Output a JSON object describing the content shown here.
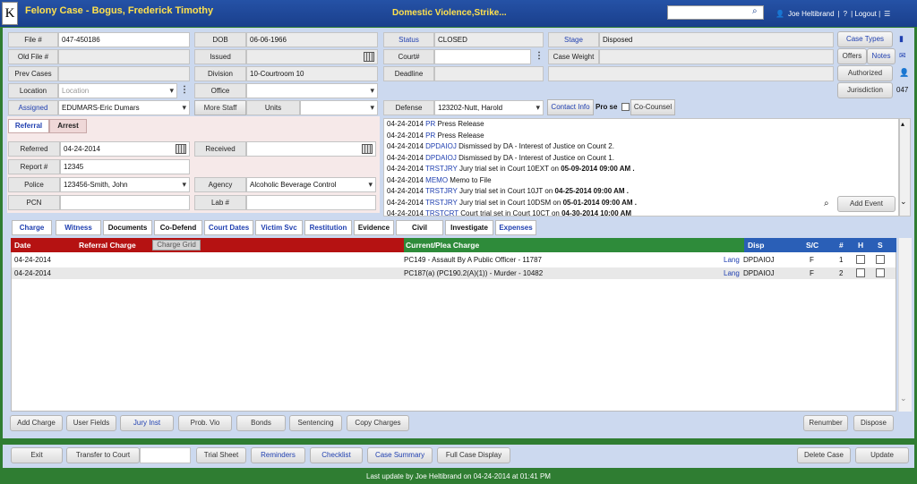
{
  "header": {
    "logo": "K",
    "title": "Felony Case - Bogus, Frederick Timothy",
    "flags": "Domestic Violence,Strike...",
    "search_placeholder": "",
    "user": "Joe Heltibrand",
    "help": "|",
    "logout": "| Logout |",
    "menu": "☰"
  },
  "left": {
    "file_label": "File #",
    "file_value": "047-450186",
    "old_file_label": "Old File #",
    "old_file_value": "",
    "prev_cases_label": "Prev Cases",
    "prev_cases_value": "",
    "location_label": "Location",
    "location_value": "Location",
    "assigned_label": "Assigned",
    "assigned_value": "EDUMARS-Eric Dumars"
  },
  "mid": {
    "dob_label": "DOB",
    "dob_value": "06-06-1966",
    "issued_label": "Issued",
    "issued_value": "",
    "division_label": "Division",
    "division_value": "10-Courtroom 10",
    "office_label": "Office",
    "office_value": "",
    "more_staff_label": "More Staff",
    "units_label": "Units",
    "units_value": ""
  },
  "right": {
    "status_label": "Status",
    "status_value": "CLOSED",
    "court_label": "Court#",
    "court_value": "",
    "deadline_label": "Deadline",
    "deadline_value": "",
    "defense_label": "Defense",
    "defense_value": "123202-Nutt, Harold",
    "contact_info": "Contact Info",
    "pro_se": "Pro se",
    "co_counsel": "Co-Counsel",
    "stage_label": "Stage",
    "stage_value": "Disposed",
    "case_weight_label": "Case Weight",
    "case_weight_value": ""
  },
  "side_buttons": {
    "case_types": "Case Types",
    "offers": "Offers",
    "notes": "Notes",
    "authorized": "Authorized",
    "jurisdiction": "Jurisdiction",
    "jurisdiction_value": "047"
  },
  "referral": {
    "tab_referral": "Referral",
    "tab_arrest": "Arrest",
    "referred_label": "Referred",
    "referred_value": "04-24-2014",
    "received_label": "Received",
    "received_value": "",
    "report_label": "Report #",
    "report_value": "12345",
    "police_label": "Police",
    "police_value": "123456-Smith, John",
    "agency_label": "Agency",
    "agency_value": "Alcoholic Beverage Control",
    "pcn_label": "PCN",
    "pcn_value": "",
    "lab_label": "Lab #",
    "lab_value": ""
  },
  "events": [
    {
      "date": "04-24-2014",
      "code": "PR",
      "text": "Press Release",
      "bold": ""
    },
    {
      "date": "04-24-2014",
      "code": "PR",
      "text": "Press Release",
      "bold": ""
    },
    {
      "date": "04-24-2014",
      "code": "DPDAIOJ",
      "text": "Dismissed by DA - Interest of Justice on Count 2.",
      "bold": ""
    },
    {
      "date": "04-24-2014",
      "code": "DPDAIOJ",
      "text": "Dismissed by DA - Interest of Justice on Count 1.",
      "bold": ""
    },
    {
      "date": "04-24-2014",
      "code": "TRSTJRY",
      "text": "Jury trial set in Court 10EXT on",
      "bold": "05-09-2014 09:00 AM ."
    },
    {
      "date": "04-24-2014",
      "code": "MEMO",
      "text": "Memo to File",
      "bold": ""
    },
    {
      "date": "04-24-2014",
      "code": "TRSTJRY",
      "text": "Jury trial set in Court 10JT on",
      "bold": "04-25-2014 09:00 AM ."
    },
    {
      "date": "04-24-2014",
      "code": "TRSTJRY",
      "text": "Jury trial set in Court 10DSM on",
      "bold": "05-01-2014 09:00 AM ."
    },
    {
      "date": "04-24-2014",
      "code": "TRSTCRT",
      "text": "Court trial set in Court 10CT on",
      "bold": "04-30-2014 10:00 AM"
    }
  ],
  "add_event": "Add Event",
  "tabs": [
    "Charge",
    "Witness",
    "Documents",
    "Co-Defend",
    "Court Dates",
    "Victim Svc",
    "Restitution",
    "Evidence",
    "Civil",
    "Investigate",
    "Expenses"
  ],
  "grid": {
    "h_date": "Date",
    "h_referral": "Referral Charge",
    "charge_grid": "Charge Grid",
    "h_current": "Current/Plea Charge",
    "h_disp": "Disp",
    "h_sc": "S/C",
    "h_num": "#",
    "h_h": "H",
    "h_s": "S",
    "rows": [
      {
        "date": "04-24-2014",
        "charge": "PC149 - Assault By A Public Officer - 11787",
        "lang": "Lang",
        "disp": "DPDAIOJ",
        "sc": "F",
        "num": "1"
      },
      {
        "date": "04-24-2014",
        "charge": "PC187(a) (PC190.2(A)(1)) - Murder - 10482",
        "lang": "Lang",
        "disp": "DPDAIOJ",
        "sc": "F",
        "num": "2"
      }
    ]
  },
  "grid_buttons": [
    "Add Charge",
    "User Fields",
    "Jury Inst",
    "Prob. Vio",
    "Bonds",
    "Sentencing",
    "Copy Charges"
  ],
  "renumber": "Renumber",
  "dispose": "Dispose",
  "footer": {
    "exit": "Exit",
    "transfer": "Transfer to Court",
    "transfer_value": "",
    "trial_sheet": "Trial Sheet",
    "reminders": "Reminders",
    "checklist": "Checklist",
    "case_summary": "Case Summary",
    "full_case": "Full Case Display",
    "delete_case": "Delete Case",
    "update": "Update"
  },
  "status_text": "Last update by Joe Heltibrand on 04-24-2014 at 01:41 PM",
  "colors": {
    "header": "#1a3f8c",
    "title": "#ffe14d",
    "panel": "#ccd9ef",
    "status_bar": "#2f7d32",
    "referral_red": "#b51212",
    "plea_green": "#2e8b3a"
  }
}
